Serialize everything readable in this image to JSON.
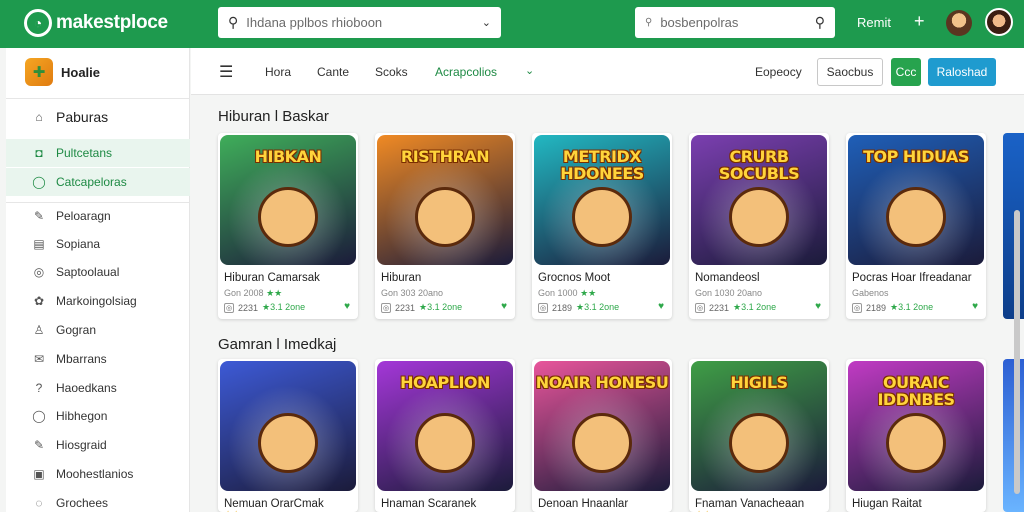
{
  "header": {
    "logo_text": "makestploce",
    "search_main": {
      "placeholder": "Ihdana pplbos rhioboon"
    },
    "search_secondary": {
      "placeholder": "bosbenpolras"
    },
    "link": "Remit",
    "plus": "+",
    "icons": {
      "logo": "logo-icon",
      "search": "search-icon",
      "chevron": "chevron-down-icon",
      "plus": "plus-icon"
    }
  },
  "sidebar": {
    "brand": "Hoalie",
    "items": [
      {
        "label": "Paburas",
        "icon": "⌂",
        "icon_name": "home-icon",
        "active": false,
        "big": true
      },
      {
        "label": "Pultcetans",
        "icon": "◘",
        "icon_name": "store-icon",
        "active": true,
        "big": false
      },
      {
        "label": "Catcapeloras",
        "icon": "◯",
        "icon_name": "circle-icon",
        "active": true,
        "big": false
      },
      {
        "label": "Peloaragn",
        "icon": "✎",
        "icon_name": "pen-icon",
        "active": false,
        "big": false
      },
      {
        "label": "Sopiana",
        "icon": "▤",
        "icon_name": "list-icon",
        "active": false,
        "big": false
      },
      {
        "label": "Saptoolaual",
        "icon": "◎",
        "icon_name": "target-icon",
        "active": false,
        "big": false
      },
      {
        "label": "Markoingolsiag",
        "icon": "✿",
        "icon_name": "gear-icon",
        "active": false,
        "big": false
      },
      {
        "label": "Gogran",
        "icon": "♙",
        "icon_name": "user-icon",
        "active": false,
        "big": false
      },
      {
        "label": "Mbarrans",
        "icon": "✉",
        "icon_name": "mail-icon",
        "active": false,
        "big": false
      },
      {
        "label": "Haoedkans",
        "icon": "?",
        "icon_name": "help-icon",
        "active": false,
        "big": false
      },
      {
        "label": "Hibhegon",
        "icon": "◯",
        "icon_name": "circle-icon",
        "active": false,
        "big": false
      },
      {
        "label": "Hiosgraid",
        "icon": "✎",
        "icon_name": "pencil-icon",
        "active": false,
        "big": false
      },
      {
        "label": "Moohestlanios",
        "icon": "▣",
        "icon_name": "grid-icon",
        "active": false,
        "big": false
      },
      {
        "label": "Grochees",
        "icon": "◌",
        "icon_name": "chat-icon",
        "active": false,
        "big": false
      }
    ]
  },
  "subnav": {
    "menu_icon": "☰",
    "links": [
      "Hora",
      "Cante",
      "Scoks",
      "Acrapcolios"
    ],
    "chevron": "⌄",
    "right_link": "Eopeocy",
    "btn_outline": "Saocbus",
    "btn_green": "Ccc",
    "btn_blue": "Raloshad"
  },
  "sections": [
    {
      "title": "Hiburan l Baskar",
      "cards": [
        {
          "art": "HIBKAN",
          "name": "Hiburan Camarsak",
          "meta": "Gon 2008",
          "stars": "★★",
          "count": "2231",
          "rating": "★3.1 2one",
          "bg": "#3fae5a"
        },
        {
          "art": "RISTHRAN",
          "name": "Hiburan",
          "meta": "Gon 303 20ano",
          "stars": "",
          "count": "2231",
          "rating": "★3.1 2one",
          "bg": "#f08a24"
        },
        {
          "art": "METRIDX HDONEES",
          "name": "Grocnos Moot",
          "meta": "Gon 1000",
          "stars": "★★",
          "count": "2189",
          "rating": "★3.1 2one",
          "bg": "#22b8c2"
        },
        {
          "art": "CRURB SOCUBLS",
          "name": "Nomandeosl",
          "meta": "Gon 1030 20ano",
          "stars": "",
          "count": "2231",
          "rating": "★3.1 2one",
          "bg": "#7b3fb0"
        },
        {
          "art": "TOP HIDUAS",
          "name": "Pocras Hoar Ifreadanar",
          "meta": "Gabenos",
          "stars": "",
          "count": "2189",
          "rating": "★3.1 2one",
          "bg": "#1f5fb8"
        }
      ]
    },
    {
      "title": "Gamran l Imedkaj",
      "cards": [
        {
          "art": "",
          "name": "Nemuan OrarCmak",
          "meta": "",
          "stars": "★★",
          "count": "",
          "rating": "",
          "bg": "#3d5ad6"
        },
        {
          "art": "HOAPLION",
          "name": "Hnaman Scaranek",
          "meta": "",
          "stars": "",
          "count": "",
          "rating": "",
          "bg": "#a437d8"
        },
        {
          "art": "NOAIR HONESU",
          "name": "Denoan Hnaanlar",
          "meta": "",
          "stars": "",
          "count": "",
          "rating": "",
          "bg": "#e8559b"
        },
        {
          "art": "HIGILS",
          "name": "Fnaman Vanacheaan",
          "meta": "",
          "stars": "★★",
          "count": "",
          "rating": "",
          "bg": "#3f9e46"
        },
        {
          "art": "OURAIC IDDNBES",
          "name": "Hiugan Raitat",
          "meta": "",
          "stars": "",
          "count": "",
          "rating": "",
          "bg": "#c13bc4"
        }
      ]
    }
  ]
}
